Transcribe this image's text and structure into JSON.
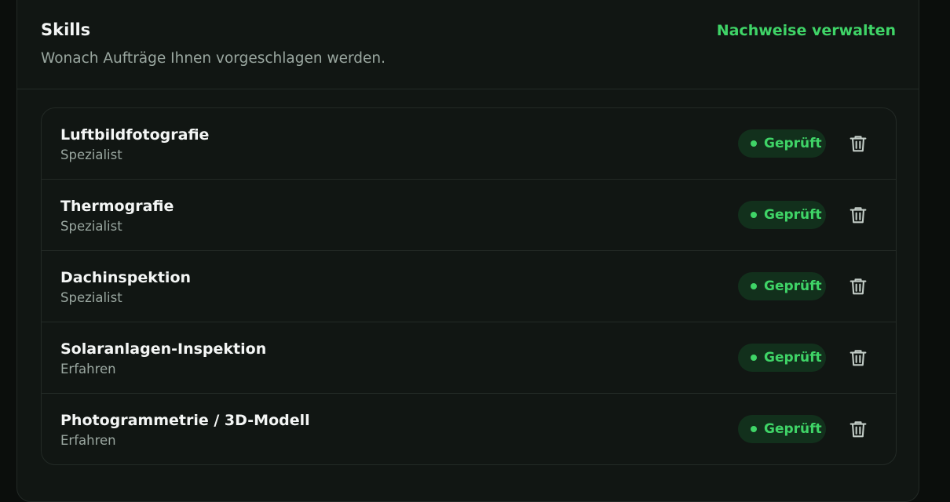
{
  "header": {
    "title": "Skills",
    "subtitle": "Wonach Aufträge Ihnen vorgeschlagen werden.",
    "manage_link": "Nachweise verwalten"
  },
  "skills": [
    {
      "name": "Luftbildfotografie",
      "level": "Spezialist",
      "status": "Geprüft"
    },
    {
      "name": "Thermografie",
      "level": "Spezialist",
      "status": "Geprüft"
    },
    {
      "name": "Dachinspektion",
      "level": "Spezialist",
      "status": "Geprüft"
    },
    {
      "name": "Solaranlagen-Inspektion",
      "level": "Erfahren",
      "status": "Geprüft"
    },
    {
      "name": "Photogrammetrie / 3D-Modell",
      "level": "Erfahren",
      "status": "Geprüft"
    }
  ],
  "icons": {
    "delete": "trash-icon",
    "status": "status-dot-icon"
  },
  "colors": {
    "accent": "#3fd467",
    "badge_background": "#12301c",
    "card_background": "#111613",
    "page_background": "#0b0e0c",
    "border": "#232a26",
    "text_primary": "#f4f6f5",
    "text_secondary": "#9aa7a0"
  }
}
